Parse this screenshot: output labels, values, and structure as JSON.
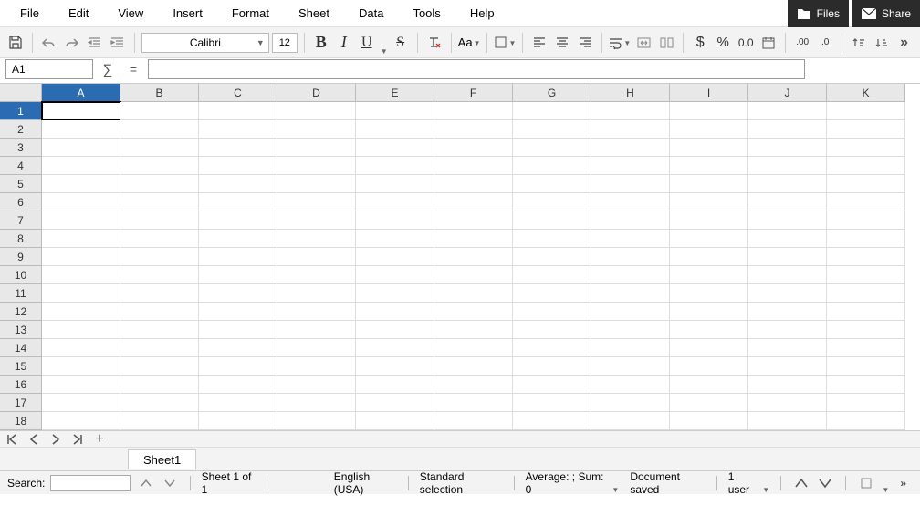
{
  "menu": [
    "File",
    "Edit",
    "View",
    "Insert",
    "Format",
    "Sheet",
    "Data",
    "Tools",
    "Help"
  ],
  "topRight": {
    "files": "Files",
    "share": "Share"
  },
  "toolbar": {
    "fontName": "Calibri",
    "fontSize": "12",
    "caseLabel": "Aa",
    "currency": "$",
    "percent": "%"
  },
  "nameBox": "A1",
  "formula": "",
  "columns": [
    "A",
    "B",
    "C",
    "D",
    "E",
    "F",
    "G",
    "H",
    "I",
    "J",
    "K"
  ],
  "rows": [
    1,
    2,
    3,
    4,
    5,
    6,
    7,
    8,
    9,
    10,
    11,
    12,
    13,
    14,
    15,
    16,
    17,
    18
  ],
  "activeCell": {
    "row": 1,
    "col": "A"
  },
  "sheetTab": "Sheet1",
  "status": {
    "searchLabel": "Search:",
    "sheetCount": "Sheet 1 of 1",
    "language": "English (USA)",
    "selection": "Standard selection",
    "stats": "Average: ; Sum: 0",
    "saveState": "Document saved",
    "users": "1 user"
  }
}
